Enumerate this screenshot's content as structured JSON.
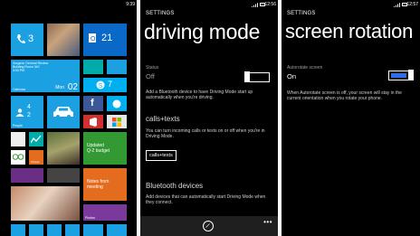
{
  "start": {
    "time": "9:39",
    "tiles": {
      "phone": {
        "count": "3"
      },
      "outlook": {
        "count": "21"
      },
      "calendar": {
        "line1": "Surgeon General Review",
        "line2": "Building Room 342",
        "line3": "3:00 PM",
        "label": "Calendar",
        "day": "Mon",
        "date": "02"
      },
      "skype": {
        "count": "7"
      },
      "people": {
        "label": "People"
      },
      "messaging": {
        "count": "4",
        "count2": "2"
      },
      "office": {
        "label": "Updated",
        "line2": "Q-2 budget"
      },
      "stocks": {
        "label": "Fitness"
      },
      "photo": {
        "label": "Notes from",
        "line2": "meeting"
      },
      "photos_tile": {
        "label": "Photos"
      }
    }
  },
  "driving": {
    "time": "12:56",
    "header": "SETTINGS",
    "title": "driving mode",
    "status_label": "Status",
    "status_value": "Off",
    "desc1": "Add a Bluetooth device to have Driving Mode start up automatically when you're driving.",
    "section1": "calls+texts",
    "desc2": "You can turn incoming calls or texts on or off when you're in Driving Mode.",
    "button": "calls+texts",
    "section2": "Bluetooth devices",
    "desc3": "Add devices that can automatically start Driving Mode when they connect.",
    "more": "•••"
  },
  "rotation": {
    "time": "12:57",
    "header": "SETTINGS",
    "title": "screen rotation",
    "label": "Autorotate screen",
    "value": "On",
    "desc": "When Autorotate screen is off, your screen will stay in the current orientation when you rotate your phone."
  },
  "colors": {
    "accent": "#2d6df6",
    "tile_blue": "#1ba1e2",
    "tile_orange": "#e46c1f",
    "tile_green": "#339933"
  }
}
